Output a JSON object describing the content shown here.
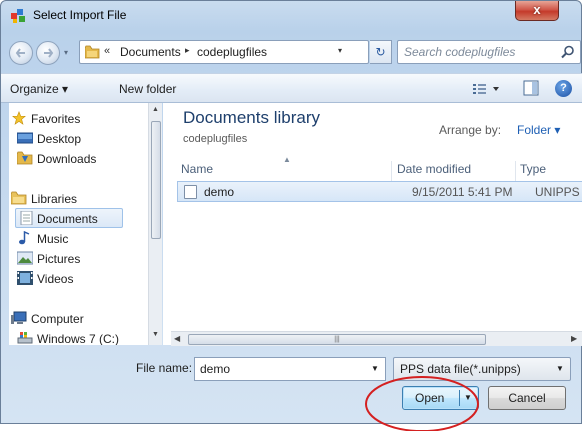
{
  "window": {
    "title": "Select Import File",
    "close_label": "x"
  },
  "address_bar": {
    "chevron": "«",
    "segments": [
      "Documents",
      "codeplugfiles"
    ],
    "separator": "▸",
    "dropdown": "▾",
    "refresh": "↻"
  },
  "search": {
    "placeholder": "Search codeplugfiles"
  },
  "toolbar": {
    "organize_label": "Organize ▾",
    "new_folder_label": "New folder"
  },
  "nav_pane": {
    "items": [
      {
        "label": "Favorites",
        "icon": "star-icon"
      },
      {
        "label": "Desktop",
        "icon": "desktop-icon"
      },
      {
        "label": "Downloads",
        "icon": "downloads-icon"
      },
      {
        "label": "Libraries",
        "icon": "libraries-icon"
      },
      {
        "label": "Documents",
        "icon": "documents-icon",
        "selected": true
      },
      {
        "label": "Music",
        "icon": "music-icon"
      },
      {
        "label": "Pictures",
        "icon": "pictures-icon"
      },
      {
        "label": "Videos",
        "icon": "videos-icon"
      },
      {
        "label": "Computer",
        "icon": "computer-icon"
      },
      {
        "label": "Windows 7 (C:)",
        "icon": "drive-icon"
      }
    ]
  },
  "main": {
    "library_title": "Documents library",
    "library_subtitle": "codeplugfiles",
    "arrange_label": "Arrange by:",
    "arrange_value": "Folder ▾",
    "columns": [
      "Name",
      "Date modified",
      "Type"
    ],
    "files": [
      {
        "name": "demo",
        "date_modified": "9/15/2011 5:41 PM",
        "type": "UNIPPS F"
      }
    ]
  },
  "bottom": {
    "file_name_label": "File name:",
    "file_name_value": "demo",
    "filter_value": "PPS data file(*.unipps)",
    "open_label": "Open",
    "cancel_label": "Cancel"
  },
  "colors": {
    "annotation_circle": "#d42020",
    "selection": "#d6e6f7",
    "library_title": "#1e3f6c"
  }
}
